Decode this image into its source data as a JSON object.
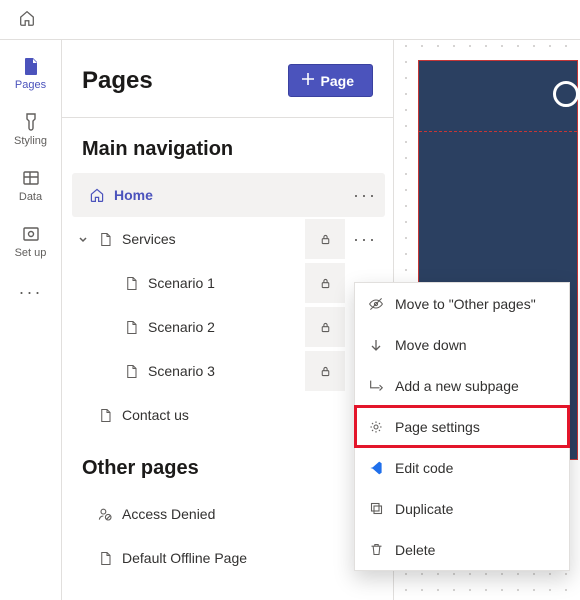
{
  "rail": {
    "pages": "Pages",
    "styling": "Styling",
    "data": "Data",
    "setup": "Set up"
  },
  "panel": {
    "title": "Pages",
    "add_button": "Page",
    "section_main": "Main navigation",
    "section_other": "Other pages",
    "tree": {
      "home": "Home",
      "services": "Services",
      "scenario1": "Scenario 1",
      "scenario2": "Scenario 2",
      "scenario3": "Scenario 3",
      "contact": "Contact us",
      "access_denied": "Access Denied",
      "offline": "Default Offline Page"
    }
  },
  "context_menu": {
    "move_other": "Move to \"Other pages\"",
    "move_down": "Move down",
    "add_subpage": "Add a new subpage",
    "settings": "Page settings",
    "edit_code": "Edit code",
    "duplicate": "Duplicate",
    "delete": "Delete"
  }
}
